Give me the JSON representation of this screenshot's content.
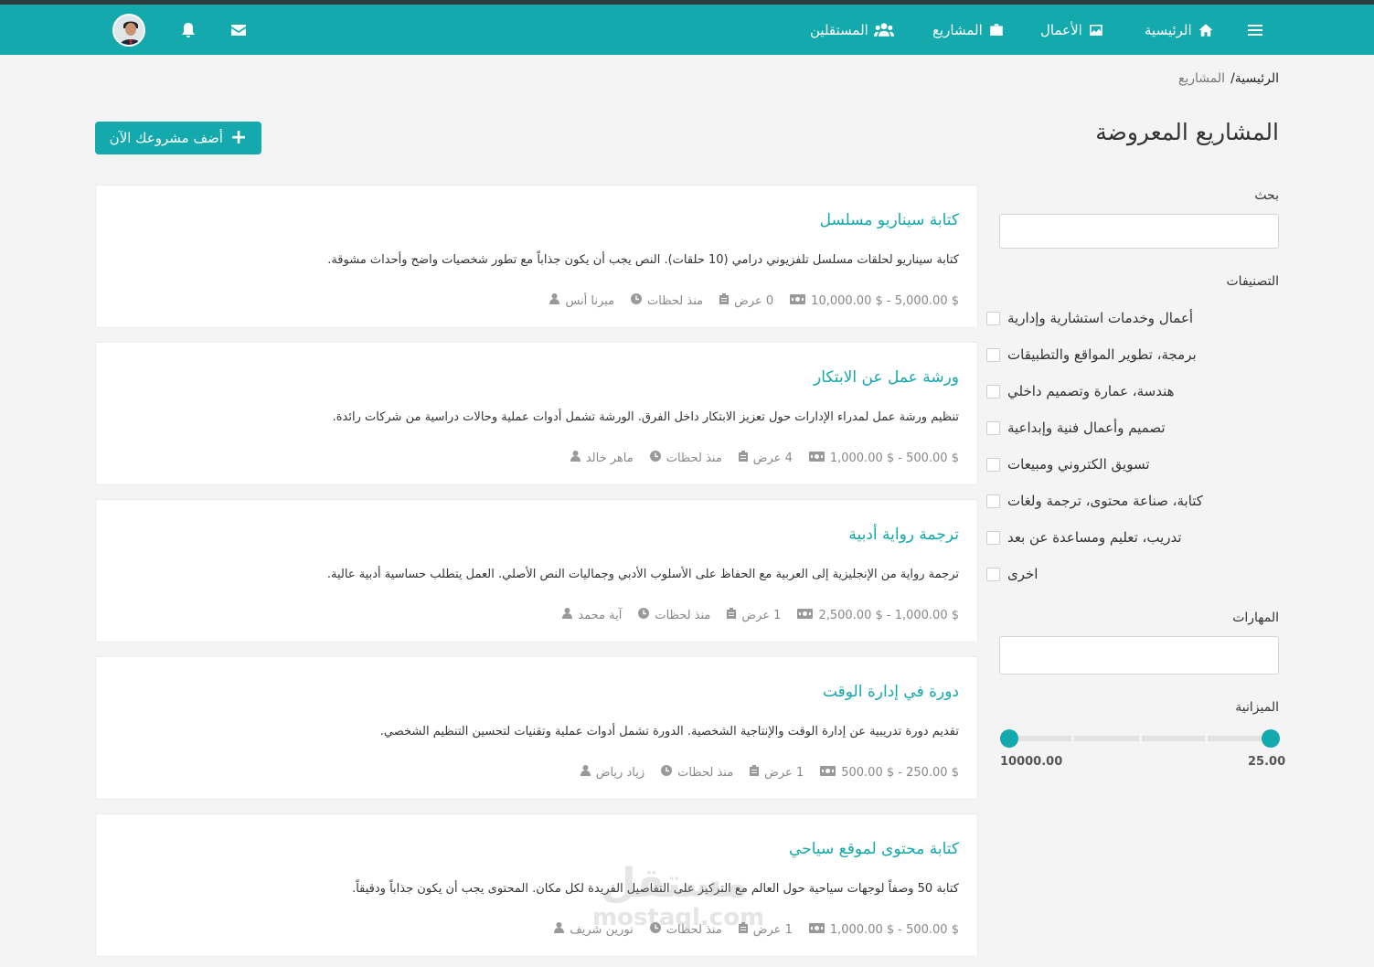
{
  "nav": {
    "home": "الرئيسية",
    "works": "الأعمال",
    "projects": "المشاريع",
    "freelancers": "المستقلين"
  },
  "breadcrumb": {
    "home": "الرئيسية/",
    "current": "المشاريع"
  },
  "page_title": "المشاريع المعروضة",
  "add_button": "أضف مشروعك الآن",
  "sidebar": {
    "search_label": "بحث",
    "categories_label": "التصنيفات",
    "categories": [
      "أعمال وخدمات استشارية وإدارية",
      "برمجة، تطوير المواقع والتطبيقات",
      "هندسة، عمارة وتصميم داخلي",
      "تصميم وأعمال فنية وإبداعية",
      "تسويق الكتروني ومبيعات",
      "كتابة، صناعة محتوى، ترجمة ولغات",
      "تدريب، تعليم ومساعدة عن بعد",
      "اخرى"
    ],
    "skills_label": "المهارات",
    "budget_label": "الميزانية",
    "budget_min": "25.00",
    "budget_max": "10000.00"
  },
  "projects": [
    {
      "title": "كتابة سيناريو مسلسل",
      "description": "كتابة سيناريو لحلقات مسلسل تلفزيوني درامي (10 حلقات). النص يجب أن يكون جذاباً مع تطور شخصيات واضح وأحداث مشوقة.",
      "author": "ميرنا أنس",
      "time": "منذ لحظات",
      "offers": "0 عرض",
      "budget": "$ 5,000.00 - $ 10,000.00"
    },
    {
      "title": "ورشة عمل عن الابتكار",
      "description": "تنظيم ورشة عمل لمدراء الإدارات حول تعزيز الابتكار داخل الفرق. الورشة تشمل أدوات عملية وحالات دراسية من شركات رائدة.",
      "author": "ماهر خالد",
      "time": "منذ لحظات",
      "offers": "4 عرض",
      "budget": "$ 500.00 - $ 1,000.00"
    },
    {
      "title": "ترجمة رواية أدبية",
      "description": "ترجمة رواية من الإنجليزية إلى العربية مع الحفاظ على الأسلوب الأدبي وجماليات النص الأصلي. العمل يتطلب حساسية أدبية عالية.",
      "author": "آية محمد",
      "time": "منذ لحظات",
      "offers": "1 عرض",
      "budget": "$ 1,000.00 - $ 2,500.00"
    },
    {
      "title": "دورة في إدارة الوقت",
      "description": "تقديم دورة تدريبية عن إدارة الوقت والإنتاجية الشخصية. الدورة تشمل أدوات عملية وتقنيات لتحسين التنظيم الشخصي.",
      "author": "زياد رياض",
      "time": "منذ لحظات",
      "offers": "1 عرض",
      "budget": "$ 250.00 - $ 500.00"
    },
    {
      "title": "كتابة محتوى لموقع سياحي",
      "description": "كتابة 50 وصفاً لوجهات سياحية حول العالم مع التركيز على التفاصيل الفريدة لكل مكان. المحتوى يجب أن يكون جذاباً ودقيقاً.",
      "author": "نورين شريف",
      "time": "منذ لحظات",
      "offers": "1 عرض",
      "budget": "$ 500.00 - $ 1,000.00"
    }
  ],
  "watermark": {
    "arabic": "مستقل",
    "latin": "mostaql.com"
  },
  "colors": {
    "accent": "#13a9ad",
    "background": "#f4f4f4"
  }
}
